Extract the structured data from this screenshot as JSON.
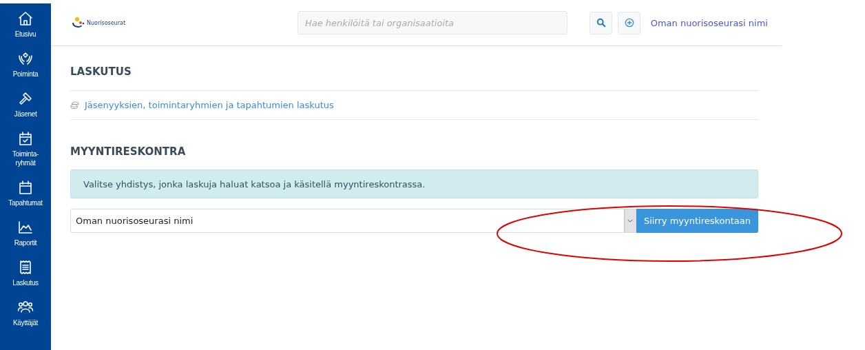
{
  "sidebar": {
    "items": [
      {
        "kind": "home",
        "label": "Etusivu"
      },
      {
        "kind": "hands",
        "label": "Poiminta"
      },
      {
        "kind": "hammer",
        "label": "Jäsenet"
      },
      {
        "kind": "calcheck",
        "label": "Toiminta-ryhmät"
      },
      {
        "kind": "calendar",
        "label": "Tapahtumat"
      },
      {
        "kind": "chart",
        "label": "Raportit"
      },
      {
        "kind": "receipt",
        "label": "Laskutus"
      },
      {
        "kind": "users",
        "label": "Käyttäjät"
      }
    ]
  },
  "header": {
    "logo_text": "Nuorisoseurat",
    "search": {
      "placeholder": "Hae henkilöitä tai organisaatioita"
    },
    "org_link": "Oman nuorisoseurasi nimi"
  },
  "billing": {
    "title": "LASKUTUS",
    "link": "Jäsenyyksien, toimintaryhmien ja tapahtumien laskutus"
  },
  "ledger": {
    "title": "MYYNTIRESKONTRA",
    "info": "Valitse yhdistys, jonka laskuja haluat katsoa ja käsitellä myyntireskontrassa.",
    "select_value": "Oman nuorisoseurasi nimi",
    "button": "Siirry myyntireskontaan"
  }
}
